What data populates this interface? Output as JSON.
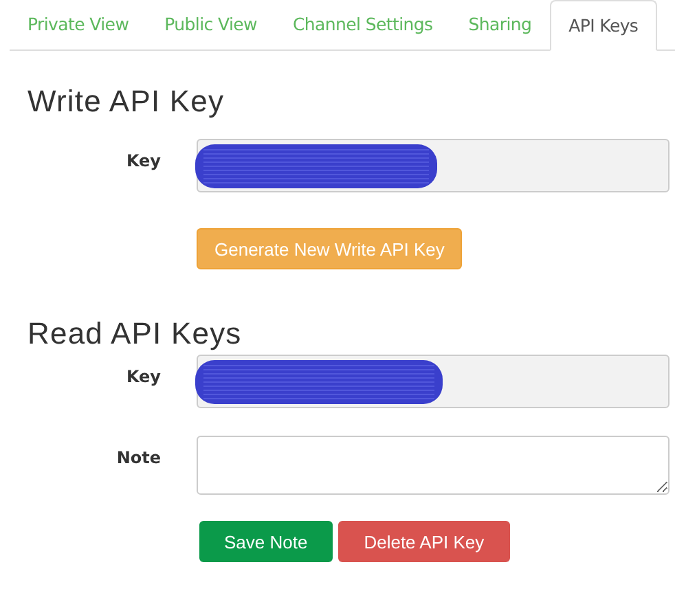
{
  "tabs": [
    {
      "label": "Private View",
      "selected": false
    },
    {
      "label": "Public View",
      "selected": false
    },
    {
      "label": "Channel Settings",
      "selected": false
    },
    {
      "label": "Sharing",
      "selected": false
    },
    {
      "label": "API Keys",
      "selected": true
    }
  ],
  "write_section": {
    "title": "Write API Key",
    "fields": [
      {
        "kind": "key",
        "label": "Key"
      }
    ],
    "buttons": [
      {
        "label": "Generate New Write API Key",
        "kind": "warning"
      }
    ]
  },
  "read_section": {
    "title": "Read API Keys",
    "fields": [
      {
        "kind": "key",
        "label": "Key"
      },
      {
        "kind": "note",
        "label": "Note"
      }
    ],
    "buttons": [
      {
        "label": "Save Note",
        "kind": "success"
      },
      {
        "label": "Delete API Key",
        "kind": "danger"
      }
    ]
  }
}
